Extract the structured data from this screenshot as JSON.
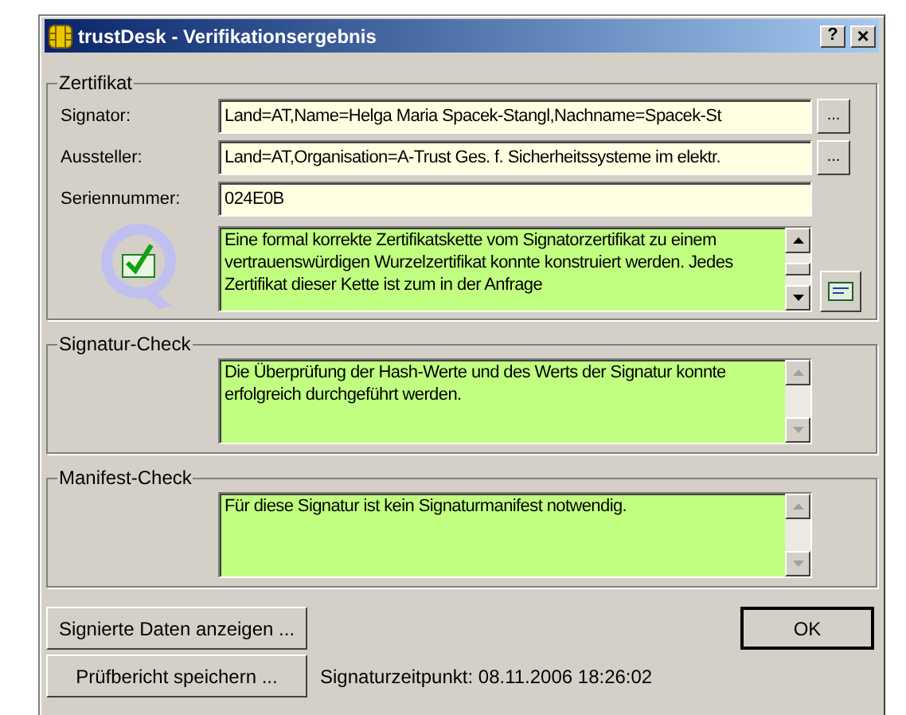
{
  "window": {
    "title": "trustDesk - Verifikationsergebnis",
    "help_button": "?",
    "close_button": "×"
  },
  "certificate": {
    "title": "Zertifikat",
    "fields": [
      {
        "label": "Signator:",
        "value": "Land=AT,Name=Helga Maria Spacek-Stangl,Nachname=Spacek-St",
        "has_details_button": true,
        "details_button": "..."
      },
      {
        "label": "Aussteller:",
        "value": "Land=AT,Organisation=A-Trust Ges. f. Sicherheitssysteme im elektr.",
        "has_details_button": true,
        "details_button": "..."
      },
      {
        "label": "Seriennummer:",
        "value": "024E0B",
        "has_details_button": false
      }
    ],
    "message": {
      "text": "Eine formal korrekte Zertifikatskette vom Signatorzertifikat zu einem vertrauenswürdigen Wurzelzertifikat konnte konstruiert werden. Jedes Zertifikat dieser Kette ist zum in der Anfrage",
      "scrollable": true
    }
  },
  "signature_check": {
    "title": "Signatur-Check",
    "message": {
      "text": "Die Überprüfung der Hash-Werte und des Werts der Signatur konnte erfolgreich durchgeführt werden.",
      "scrollable": false
    }
  },
  "manifest_check": {
    "title": "Manifest-Check",
    "message": {
      "text": "Für diese Signatur ist kein Signaturmanifest notwendig.",
      "scrollable": false
    }
  },
  "buttons": {
    "show_data": "Signierte Daten anzeigen ...",
    "save_report": "Prüfbericht speichern ...",
    "ok": "OK"
  },
  "timestamp": "Signaturzeitpunkt: 08.11.2006 18:26:02"
}
